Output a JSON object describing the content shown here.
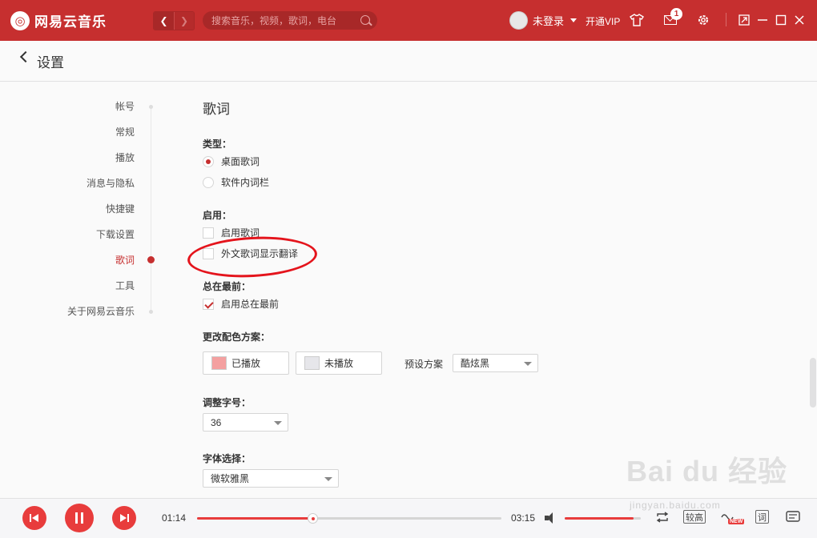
{
  "app": {
    "name": "网易云音乐",
    "search_placeholder": "搜索音乐，视频，歌词，电台",
    "user_label": "未登录",
    "vip_label": "开通VIP",
    "mail_badge": "1",
    "brand_color": "#c62f2f"
  },
  "header": {
    "title": "设置"
  },
  "sidebar": {
    "items": [
      {
        "label": "帐号",
        "active": false
      },
      {
        "label": "常规",
        "active": false
      },
      {
        "label": "播放",
        "active": false
      },
      {
        "label": "消息与隐私",
        "active": false
      },
      {
        "label": "快捷键",
        "active": false
      },
      {
        "label": "下载设置",
        "active": false
      },
      {
        "label": "歌词",
        "active": true
      },
      {
        "label": "工具",
        "active": false
      },
      {
        "label": "关于网易云音乐",
        "active": false
      }
    ]
  },
  "lyrics": {
    "title": "歌词",
    "type_label": "类型：",
    "type_options": [
      {
        "label": "桌面歌词",
        "selected": true
      },
      {
        "label": "软件内词栏",
        "selected": false
      }
    ],
    "enable_label": "启用：",
    "enable_options": [
      {
        "label": "启用歌词",
        "checked": false
      },
      {
        "label": "外文歌词显示翻译",
        "checked": false
      }
    ],
    "ontop_label": "总在最前：",
    "ontop_option": {
      "label": "启用总在最前",
      "checked": true
    },
    "color_label": "更改配色方案：",
    "played_label": "已播放",
    "played_color": "#f4a0a0",
    "unplayed_label": "未播放",
    "unplayed_color": "#e6e6ea",
    "preset_label": "预设方案",
    "preset_value": "酷炫黑",
    "size_label": "调整字号：",
    "size_value": "36",
    "font_label": "字体选择：",
    "font_value": "微软雅黑"
  },
  "player": {
    "current_time": "01:14",
    "total_time": "03:15",
    "progress": 0.38,
    "volume": 0.9,
    "quality_label": "较高",
    "lyric_label": "词",
    "new_tag": "NEW"
  },
  "watermark": {
    "brand": "Bai du 经验",
    "url": "jingyan.baidu.com"
  }
}
